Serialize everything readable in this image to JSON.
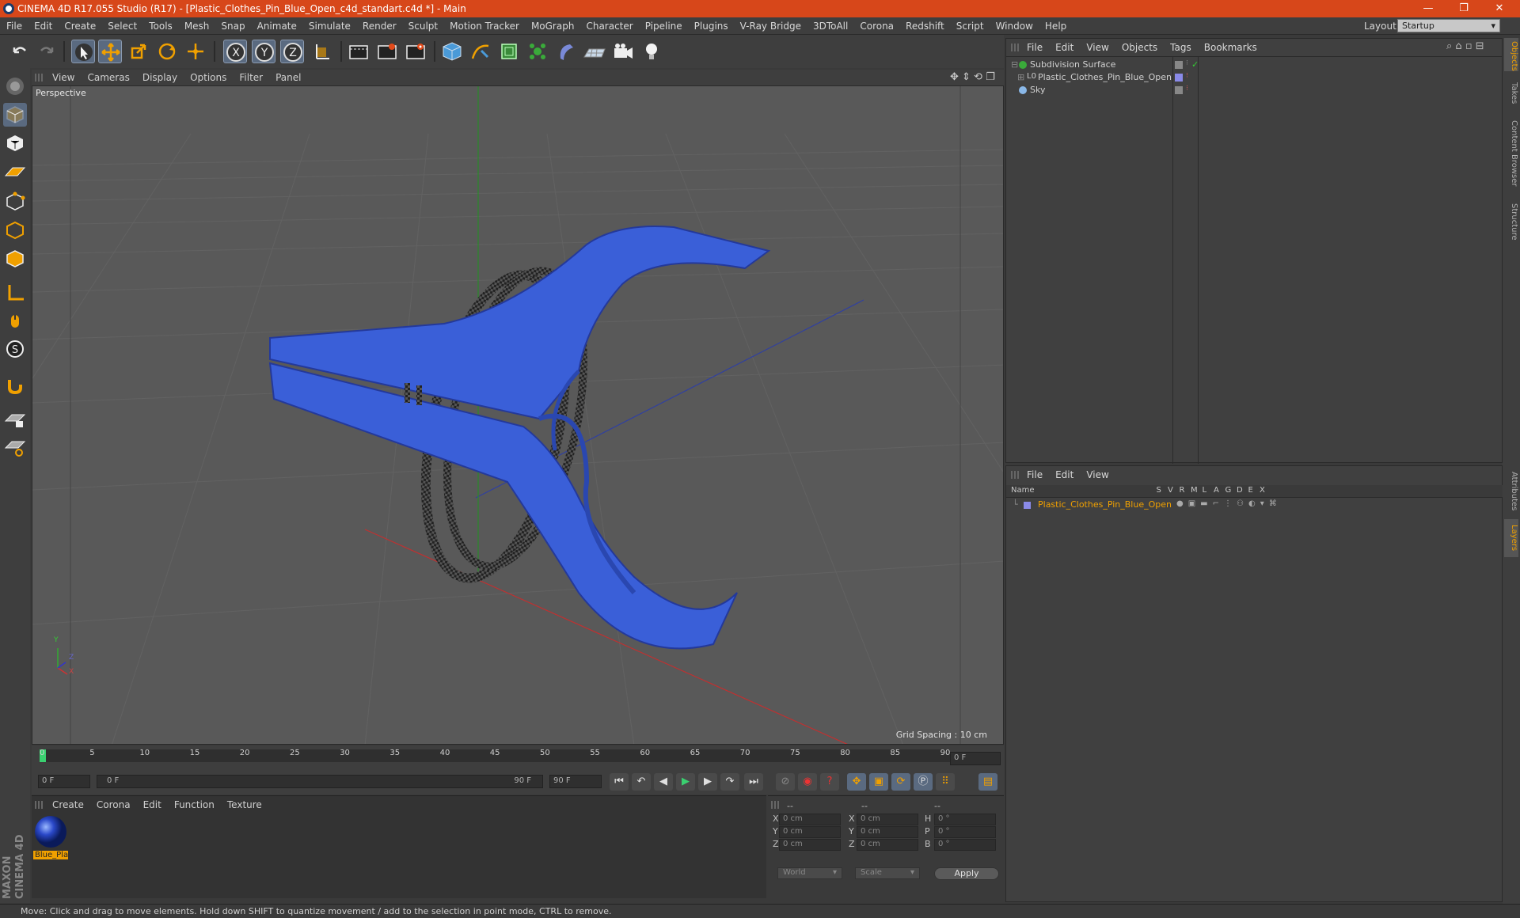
{
  "window": {
    "title": "CINEMA 4D R17.055 Studio (R17) - [Plastic_Clothes_Pin_Blue_Open_c4d_standart.c4d *] - Main",
    "minimize": "—",
    "restore": "❐",
    "close": "✕"
  },
  "menubar": {
    "items": [
      "File",
      "Edit",
      "Create",
      "Select",
      "Tools",
      "Mesh",
      "Snap",
      "Animate",
      "Simulate",
      "Render",
      "Sculpt",
      "Motion Tracker",
      "MoGraph",
      "Character",
      "Pipeline",
      "Plugins",
      "V-Ray Bridge",
      "3DToAll",
      "Corona",
      "Redshift",
      "Script",
      "Window",
      "Help"
    ],
    "layout_label": "Layout:",
    "layout_value": "Startup"
  },
  "viewport": {
    "menu": [
      "View",
      "Cameras",
      "Display",
      "Options",
      "Filter",
      "Panel"
    ],
    "label": "Perspective",
    "grid_spacing": "Grid Spacing : 10 cm",
    "axis_y": "Y",
    "axis_z": "Z",
    "axis_x": "X"
  },
  "timeline": {
    "ticks": [
      "0",
      "5",
      "10",
      "15",
      "20",
      "25",
      "30",
      "35",
      "40",
      "45",
      "50",
      "55",
      "60",
      "65",
      "70",
      "75",
      "80",
      "85",
      "90"
    ],
    "current_frame": "0 F",
    "start_field": "0 F",
    "range_start": "0 F",
    "range_end": "90 F",
    "end_field": "90 F"
  },
  "material_panel": {
    "menu": [
      "Create",
      "Corona",
      "Edit",
      "Function",
      "Texture"
    ],
    "material_name": "Blue_Pla"
  },
  "coord_panel": {
    "headers": [
      "--",
      "--",
      "--"
    ],
    "rows": [
      {
        "a": "X",
        "av": "0 cm",
        "b": "X",
        "bv": "0 cm",
        "c": "H",
        "cv": "0 °"
      },
      {
        "a": "Y",
        "av": "0 cm",
        "b": "Y",
        "bv": "0 cm",
        "c": "P",
        "cv": "0 °"
      },
      {
        "a": "Z",
        "av": "0 cm",
        "b": "Z",
        "bv": "0 cm",
        "c": "B",
        "cv": "0 °"
      }
    ],
    "mode1": "World",
    "mode2": "Scale",
    "apply": "Apply"
  },
  "object_manager": {
    "menu": [
      "File",
      "Edit",
      "View",
      "Objects",
      "Tags",
      "Bookmarks"
    ],
    "objects": [
      {
        "name": "Subdivision Surface"
      },
      {
        "name": "Plastic_Clothes_Pin_Blue_Open"
      },
      {
        "name": "Sky"
      }
    ]
  },
  "layer_manager": {
    "menu": [
      "File",
      "Edit",
      "View"
    ],
    "columns": [
      "Name",
      "S",
      "V",
      "R",
      "M",
      "L",
      "A",
      "G",
      "D",
      "E",
      "X"
    ],
    "layer_name": "Plastic_Clothes_Pin_Blue_Open"
  },
  "right_tabs": [
    "Objects",
    "Takes",
    "Content Browser",
    "Structure",
    "Attributes",
    "Layers"
  ],
  "status": "Move: Click and drag to move elements. Hold down SHIFT to quantize movement / add to the selection in point mode, CTRL to remove.",
  "brand": "MAXON CINEMA 4D",
  "colors": {
    "accent": "#d7471a",
    "model_blue": "#3a5fd8",
    "layer_orange": "#f0a000"
  }
}
